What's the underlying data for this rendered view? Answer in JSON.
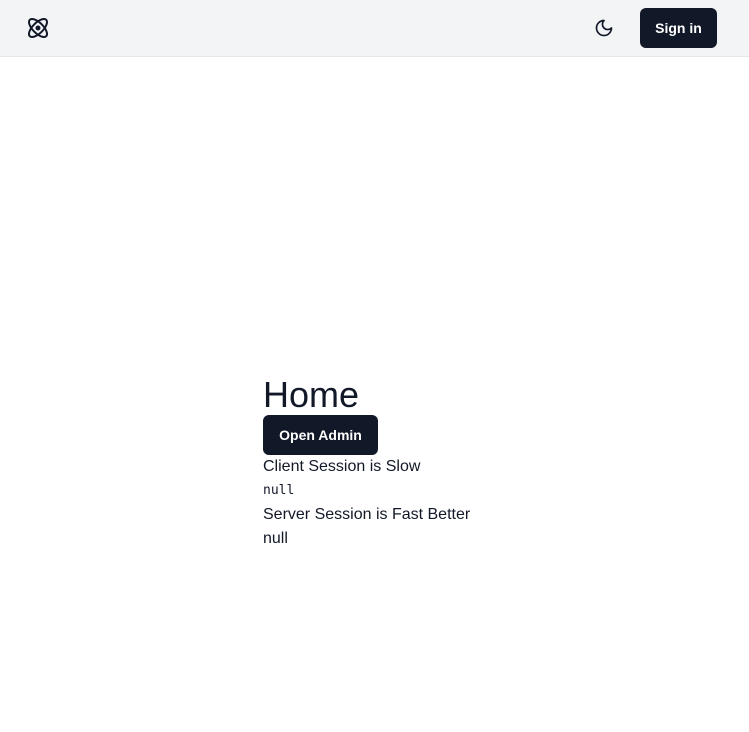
{
  "header": {
    "logo_icon": "atom-icon",
    "theme_icon": "moon-icon",
    "signin_label": "Sign in"
  },
  "main": {
    "title": "Home",
    "admin_button_label": "Open Admin",
    "client_session_label": "Client Session is Slow",
    "client_session_value": "null",
    "server_session_label": "Server Session is Fast Better",
    "server_session_value": "null"
  },
  "colors": {
    "header_bg": "#f3f4f6",
    "button_bg": "#111827",
    "text": "#111827"
  }
}
